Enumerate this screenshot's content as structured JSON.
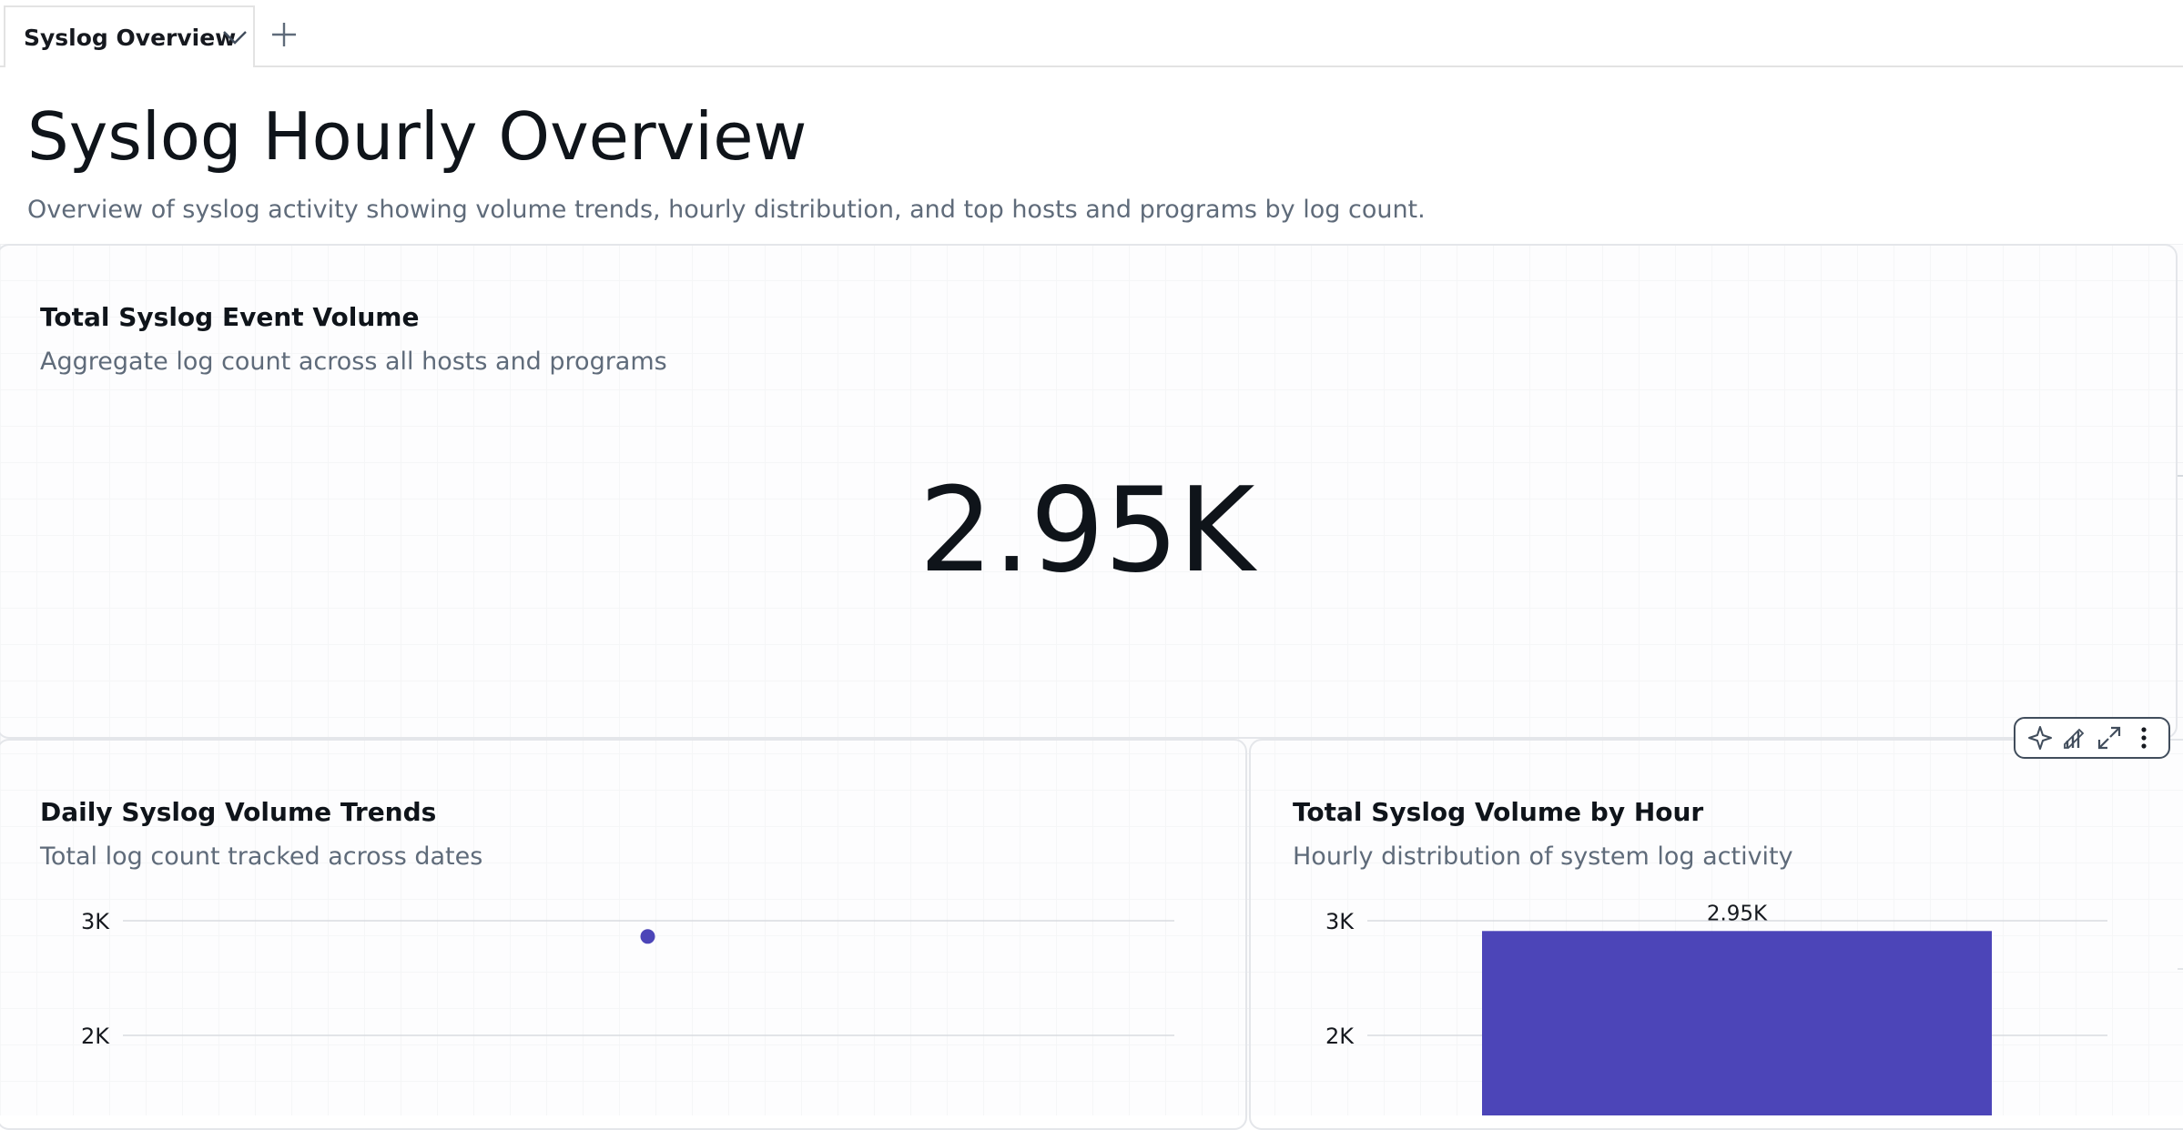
{
  "tabs": [
    {
      "label": "Syslog Overview",
      "active": true
    }
  ],
  "page": {
    "title": "Syslog Hourly Overview",
    "description": "Overview of syslog activity showing volume trends, hourly distribution, and top hosts and programs by log count."
  },
  "kpi_card": {
    "title": "Total Syslog Event Volume",
    "subtitle": "Aggregate log count across all hosts and programs",
    "value": "2.95K"
  },
  "toolbar": {
    "icons": [
      "sparkle-icon",
      "chart-edit-icon",
      "expand-icon",
      "more-vertical-icon"
    ]
  },
  "colors": {
    "accent": "#4c45b8",
    "gridline": "#d9dce0",
    "text_muted": "#5f6b7a"
  },
  "chart_data": [
    {
      "type": "line",
      "title": "Daily Syslog Volume Trends",
      "subtitle": "Total log count tracked across dates",
      "y_tick_labels": [
        "3K",
        "2K"
      ],
      "y_ticks": [
        3000,
        2000
      ],
      "series": [
        {
          "values": [
            2950
          ]
        }
      ],
      "grid": true
    },
    {
      "type": "bar",
      "title": "Total Syslog Volume by Hour",
      "subtitle": "Hourly distribution of system log activity",
      "y_tick_labels": [
        "3K",
        "2K"
      ],
      "y_ticks": [
        3000,
        2000
      ],
      "values": [
        2950
      ],
      "data_labels": [
        "2.95K"
      ],
      "grid": true
    }
  ]
}
